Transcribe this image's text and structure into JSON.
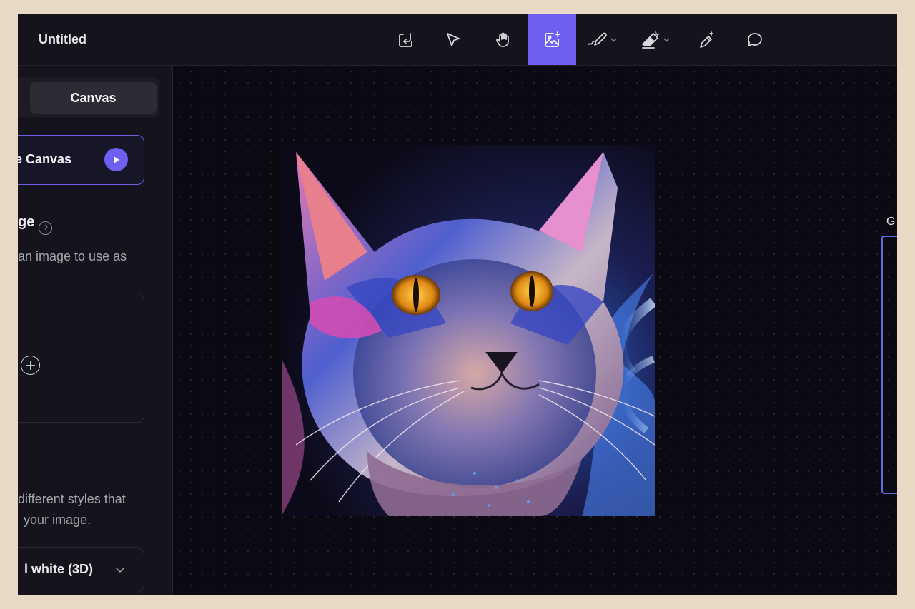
{
  "window": {
    "title": "Untitled"
  },
  "toolbar": {
    "tools": [
      {
        "name": "import",
        "icon": "import-icon",
        "active": false
      },
      {
        "name": "select",
        "icon": "pointer-icon",
        "active": false
      },
      {
        "name": "pan",
        "icon": "hand-icon",
        "active": false
      },
      {
        "name": "generate",
        "icon": "image-sparkle-icon",
        "active": true
      },
      {
        "name": "draw",
        "icon": "pencil-icon",
        "active": false,
        "has_dropdown": true
      },
      {
        "name": "erase",
        "icon": "eraser-icon",
        "active": false,
        "has_dropdown": true
      },
      {
        "name": "magic",
        "icon": "magic-wand-icon",
        "active": false
      },
      {
        "name": "comment",
        "icon": "comment-icon",
        "active": false
      }
    ],
    "accent_color": "#6d5ff0"
  },
  "sidebar": {
    "segment_active": "Canvas",
    "use_canvas_label": "se Canvas",
    "image_section": {
      "heading": "ge",
      "description": "an image to use as"
    },
    "styles_section": {
      "description_line1": "different styles that",
      "description_line2": "your image.",
      "selected_style": "l white (3D)"
    }
  },
  "canvas": {
    "right_panel_label": "G"
  }
}
